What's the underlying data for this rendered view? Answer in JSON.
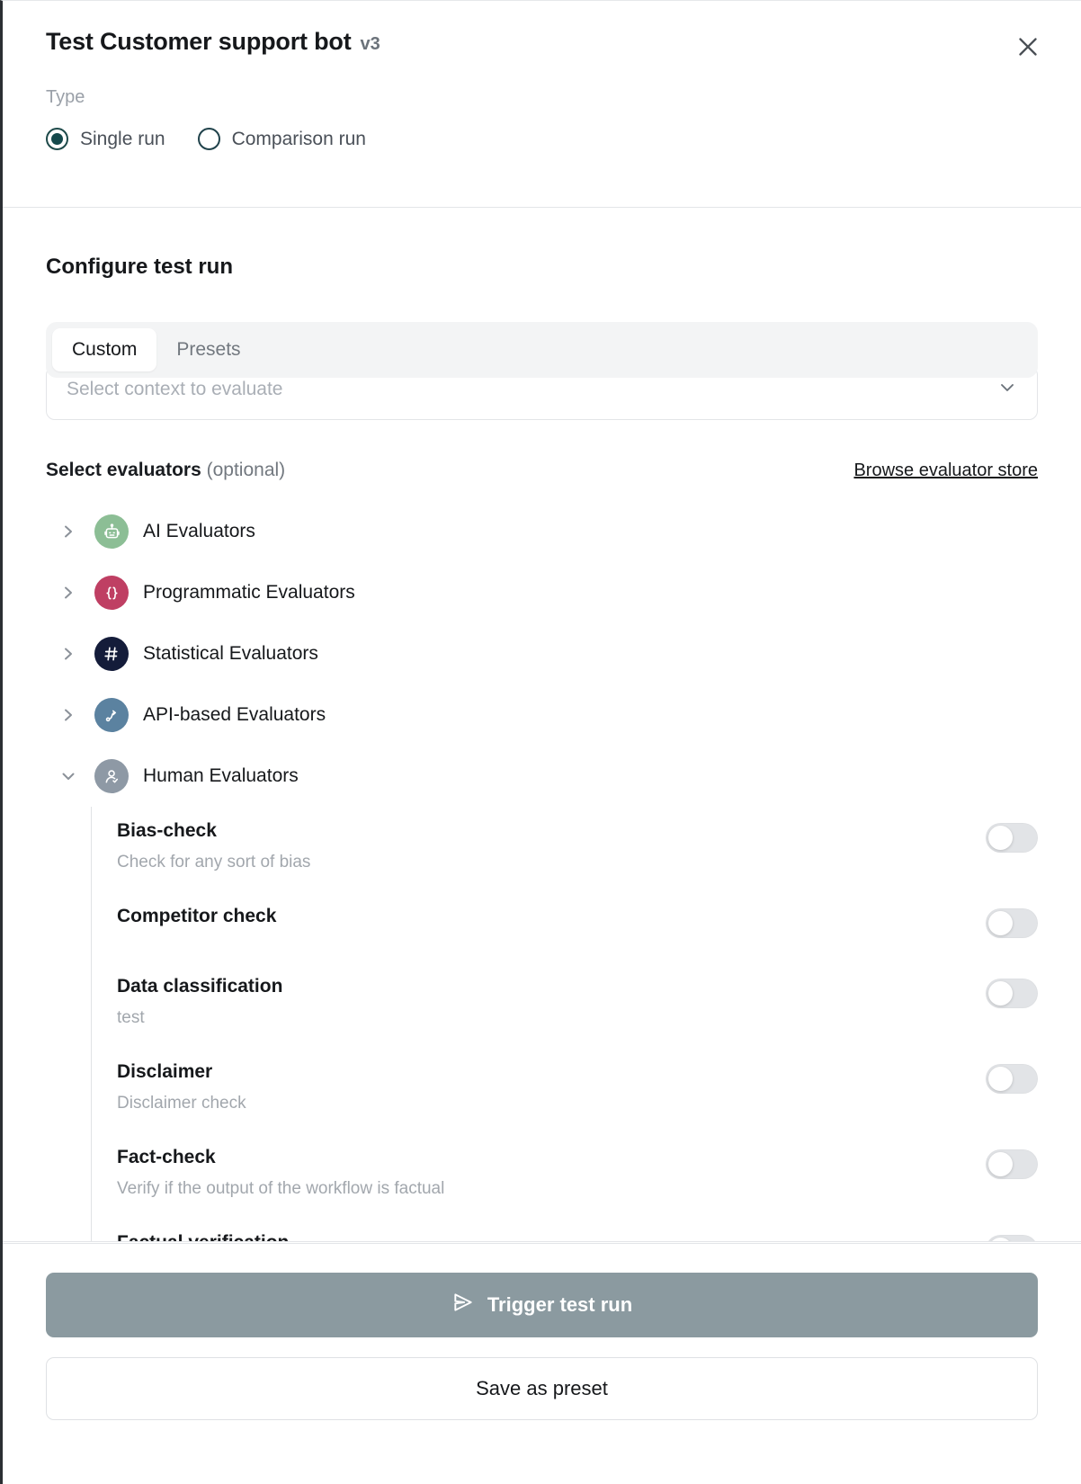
{
  "header": {
    "title": "Test Customer support bot",
    "version": "v3",
    "close_icon": "close-icon",
    "type_label": "Type",
    "run_types": [
      {
        "label": "Single run",
        "selected": true
      },
      {
        "label": "Comparison run",
        "selected": false
      }
    ]
  },
  "main": {
    "section_title": "Configure test run",
    "tabs": [
      {
        "label": "Custom",
        "active": true
      },
      {
        "label": "Presets",
        "active": false
      }
    ],
    "context_select": {
      "placeholder": "Select context to evaluate",
      "value": "",
      "chevron_icon": "chevron-down-icon"
    },
    "evaluators_header": {
      "label": "Select evaluators",
      "optional": "(optional)",
      "store_link": "Browse evaluator store"
    },
    "categories": [
      {
        "label": "AI Evaluators",
        "icon": "robot-icon",
        "color": "#8cbe95",
        "expanded": false,
        "chevron": "chevron-right-icon"
      },
      {
        "label": "Programmatic Evaluators",
        "icon": "braces-icon",
        "color": "#bf3f63",
        "expanded": false,
        "chevron": "chevron-right-icon"
      },
      {
        "label": "Statistical Evaluators",
        "icon": "hash-icon",
        "color": "#141c3a",
        "expanded": false,
        "chevron": "chevron-right-icon"
      },
      {
        "label": "API-based Evaluators",
        "icon": "api-node-icon",
        "color": "#5b82a0",
        "expanded": false,
        "chevron": "chevron-right-icon"
      },
      {
        "label": "Human Evaluators",
        "icon": "user-check-icon",
        "color": "#8e99a5",
        "expanded": true,
        "chevron": "chevron-down-icon"
      }
    ],
    "human_evaluators": [
      {
        "name": "Bias-check",
        "description": "Check for any sort of bias",
        "enabled": false
      },
      {
        "name": "Competitor check",
        "description": "",
        "enabled": false
      },
      {
        "name": "Data classification",
        "description": "test",
        "enabled": false
      },
      {
        "name": "Disclaimer",
        "description": "Disclaimer check",
        "enabled": false
      },
      {
        "name": "Fact-check",
        "description": "Verify if the output of the workflow is factual",
        "enabled": false
      },
      {
        "name": "Factual verification",
        "description": "",
        "enabled": false
      }
    ]
  },
  "footer": {
    "primary_button": {
      "label": "Trigger test run",
      "icon": "send-icon"
    },
    "secondary_button": {
      "label": "Save as preset"
    }
  },
  "colors": {
    "accent": "#14494c",
    "primary_button_bg": "#8b9aa0",
    "muted_text": "#a2a7ad"
  }
}
